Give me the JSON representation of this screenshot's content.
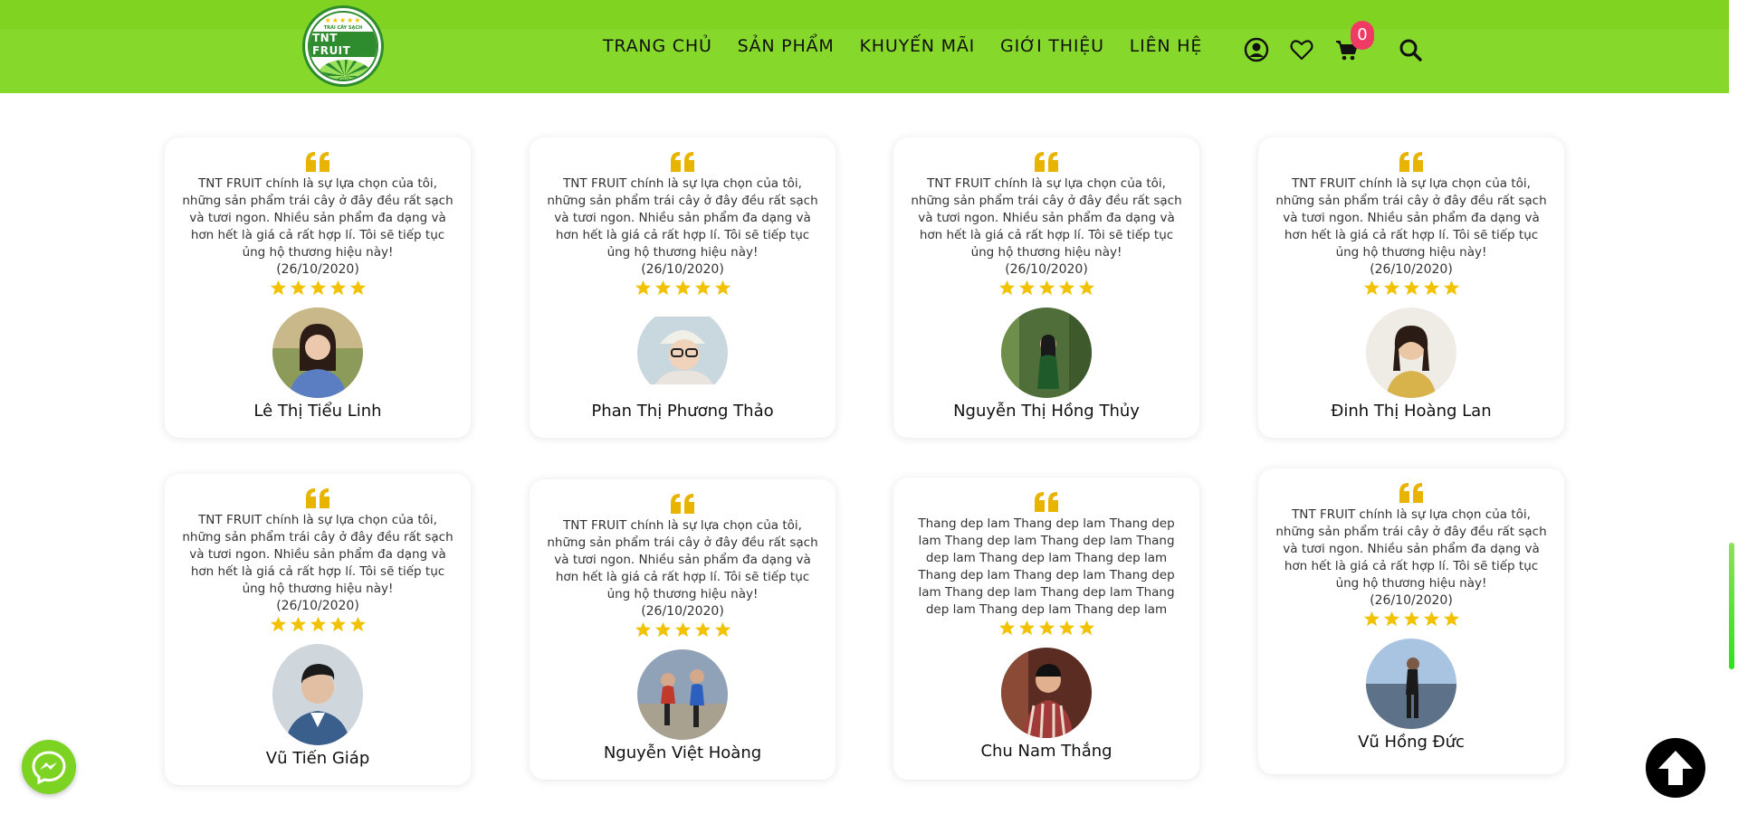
{
  "colors": {
    "header_bg": "#86d92a",
    "accent_star": "#f2c200",
    "cart_badge": "#ef3b63",
    "messenger_btn": "#7cd321"
  },
  "header": {
    "logo": {
      "brand": "TNT FRUIT",
      "tagline": "TRÁI CÂY SẠCH",
      "icon": "lime-slice-logo"
    },
    "nav": [
      {
        "label": "TRANG CHỦ"
      },
      {
        "label": "SẢN PHẨM"
      },
      {
        "label": "KHUYẾN MÃI"
      },
      {
        "label": "GIỚI THIỆU"
      },
      {
        "label": "LIÊN HỆ"
      }
    ],
    "icons": [
      "user-circle-icon",
      "heart-icon",
      "cart-icon",
      "search-icon"
    ],
    "cart_count": "0"
  },
  "reviews": [
    {
      "text": "TNT FRUIT chính là sự lựa chọn của tôi, những sản phẩm trái cây ở đây đều rất sạch và tươi ngon. Nhiều sản phẩm đa dạng và hơn hết là giá cả rất hợp lí. Tôi sẽ tiếp tục ủng hộ thương hiệu này!",
      "date": "(26/10/2020)",
      "rating": 5,
      "name": "Lê Thị Tiểu Linh"
    },
    {
      "text": "TNT FRUIT chính là sự lựa chọn của tôi, những sản phẩm trái cây ở đây đều rất sạch và tươi ngon. Nhiều sản phẩm đa dạng và hơn hết là giá cả rất hợp lí. Tôi sẽ tiếp tục ủng hộ thương hiệu này!",
      "date": "(26/10/2020)",
      "rating": 5,
      "name": "Phan Thị Phương Thảo"
    },
    {
      "text": "TNT FRUIT chính là sự lựa chọn của tôi, những sản phẩm trái cây ở đây đều rất sạch và tươi ngon. Nhiều sản phẩm đa dạng và hơn hết là giá cả rất hợp lí. Tôi sẽ tiếp tục ủng hộ thương hiệu này!",
      "date": "(26/10/2020)",
      "rating": 5,
      "name": "Nguyễn Thị Hồng Thủy"
    },
    {
      "text": "TNT FRUIT chính là sự lựa chọn của tôi, những sản phẩm trái cây ở đây đều rất sạch và tươi ngon. Nhiều sản phẩm đa dạng và hơn hết là giá cả rất hợp lí. Tôi sẽ tiếp tục ủng hộ thương hiệu này!",
      "date": "(26/10/2020)",
      "rating": 5,
      "name": "Đinh Thị Hoàng Lan"
    },
    {
      "text": "TNT FRUIT chính là sự lựa chọn của tôi, những sản phẩm trái cây ở đây đều rất sạch và tươi ngon. Nhiều sản phẩm đa dạng và hơn hết là giá cả rất hợp lí. Tôi sẽ tiếp tục ủng hộ thương hiệu này!",
      "date": "(26/10/2020)",
      "rating": 5,
      "name": "Vũ Tiến Giáp"
    },
    {
      "text": "TNT FRUIT chính là sự lựa chọn của tôi, những sản phẩm trái cây ở đây đều rất sạch và tươi ngon. Nhiều sản phẩm đa dạng và hơn hết là giá cả rất hợp lí. Tôi sẽ tiếp tục ủng hộ thương hiệu này!",
      "date": "(26/10/2020)",
      "rating": 5,
      "name": "Nguyễn Việt Hoàng"
    },
    {
      "text": "Thang dep lam Thang dep lam Thang dep lam Thang dep lam Thang dep lam Thang dep lam Thang dep lam Thang dep lam Thang dep lam Thang dep lam Thang dep lam Thang dep lam Thang dep lam Thang dep lam Thang dep lam Thang dep lam",
      "date": "",
      "rating": 5,
      "name": "Chu Nam Thắng"
    },
    {
      "text": "TNT FRUIT chính là sự lựa chọn của tôi, những sản phẩm trái cây ở đây đều rất sạch và tươi ngon. Nhiều sản phẩm đa dạng và hơn hết là giá cả rất hợp lí. Tôi sẽ tiếp tục ủng hộ thương hiệu này!",
      "date": "(26/10/2020)",
      "rating": 5,
      "name": "Vũ Hồng Đức"
    }
  ],
  "floating": {
    "messenger_icon": "messenger-icon",
    "back_to_top_icon": "arrow-up-icon"
  }
}
